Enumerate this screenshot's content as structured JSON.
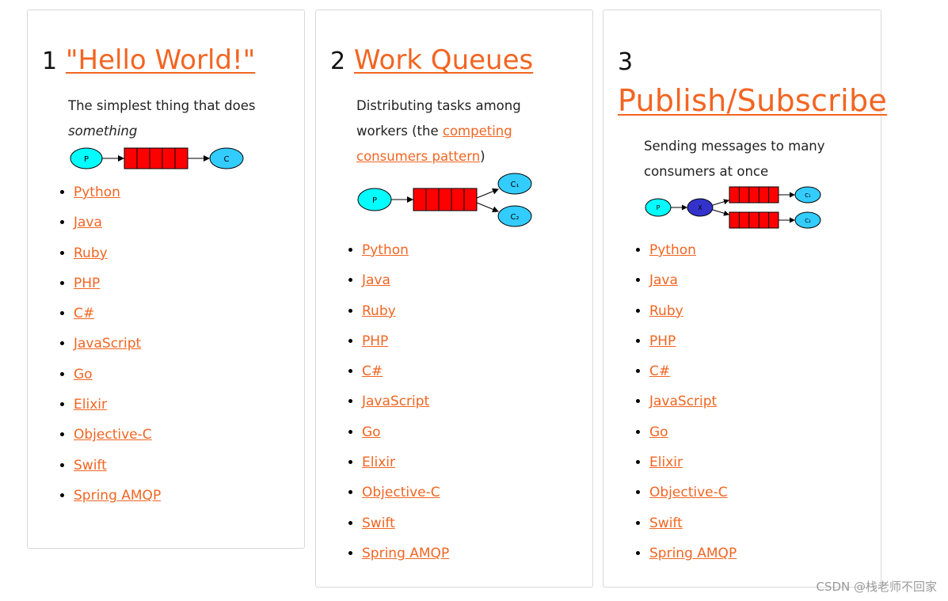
{
  "cards": [
    {
      "number": "1",
      "title": "\"Hello World!\"",
      "desc_line1": "The simplest thing that does",
      "desc_emph": "something",
      "diagram": {
        "producer": "P",
        "consumer": "C"
      },
      "languages": [
        "Python",
        "Java",
        "Ruby",
        "PHP",
        "C#",
        "JavaScript",
        "Go",
        "Elixir",
        "Objective-C",
        "Swift",
        "Spring AMQP"
      ]
    },
    {
      "number": "2",
      "title": "Work Queues",
      "desc_line1": "Distributing tasks among",
      "desc_pre": "workers (the ",
      "desc_link": "competing",
      "desc_link2": "consumers pattern",
      "desc_post": ")",
      "diagram": {
        "producer": "P",
        "consumer1": "C₁",
        "consumer2": "C₂"
      },
      "languages": [
        "Python",
        "Java",
        "Ruby",
        "PHP",
        "C#",
        "JavaScript",
        "Go",
        "Elixir",
        "Objective-C",
        "Swift",
        "Spring AMQP"
      ]
    },
    {
      "number": "3",
      "title": "Publish/Subscribe",
      "desc_line1": "Sending messages to many",
      "desc_line2": "consumers at once",
      "diagram": {
        "producer": "P",
        "exchange": "X",
        "consumer1": "C₁",
        "consumer2": "C₂"
      },
      "languages": [
        "Python",
        "Java",
        "Ruby",
        "PHP",
        "C#",
        "JavaScript",
        "Go",
        "Elixir",
        "Objective-C",
        "Swift",
        "Spring AMQP"
      ]
    }
  ],
  "colors": {
    "link": "#f26522",
    "producer": "#00ffff",
    "consumer": "#33ccff",
    "queue": "#ff0000",
    "exchange": "#3333cc"
  },
  "watermark": "CSDN @栈老师不回家"
}
